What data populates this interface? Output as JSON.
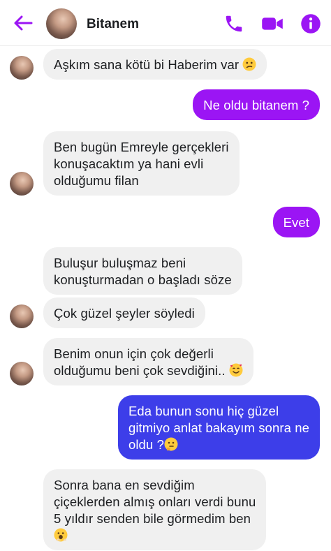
{
  "header": {
    "contact_name": "Bitanem",
    "back_icon": "arrow-left-icon",
    "call_icon": "phone-icon",
    "video_icon": "video-camera-icon",
    "info_icon": "info-icon",
    "accent_color": "#9b15f4"
  },
  "messages": [
    {
      "from": "contact",
      "lines": [
        "Aşkım sana kötü bi Haberim var"
      ],
      "emoji": "confused-face"
    },
    {
      "from": "me",
      "lines": [
        "Ne oldu bitanem ?"
      ]
    },
    {
      "from": "contact",
      "lines": [
        "Ben bugün Emreyle gerçekleri",
        "konuşacaktım ya hani evli",
        "olduğumu filan"
      ]
    },
    {
      "from": "me",
      "lines": [
        "Evet"
      ]
    },
    {
      "from": "contact",
      "lines": [
        "Buluşur buluşmaz beni",
        "konuşturmadan o başladı söze"
      ]
    },
    {
      "from": "contact",
      "lines": [
        "Çok güzel şeyler söyledi"
      ]
    },
    {
      "from": "contact",
      "lines": [
        "Benim onun için çok değerli",
        "olduğumu beni çok sevdiğini.."
      ],
      "emoji": "smiling-face-with-hearts"
    },
    {
      "from": "me",
      "lines": [
        "Eda bunun sonu hiç güzel",
        "gitmiyo anlat bakayım sonra ne",
        "oldu ?"
      ],
      "emoji": "thinking-face"
    },
    {
      "from": "contact",
      "lines": [
        "Sonra bana en sevdiğim",
        "çiçeklerden almış onları verdi bunu",
        "5 yıldır senden bile görmedim ben",
        ""
      ],
      "emoji": "face-with-open-mouth"
    }
  ]
}
